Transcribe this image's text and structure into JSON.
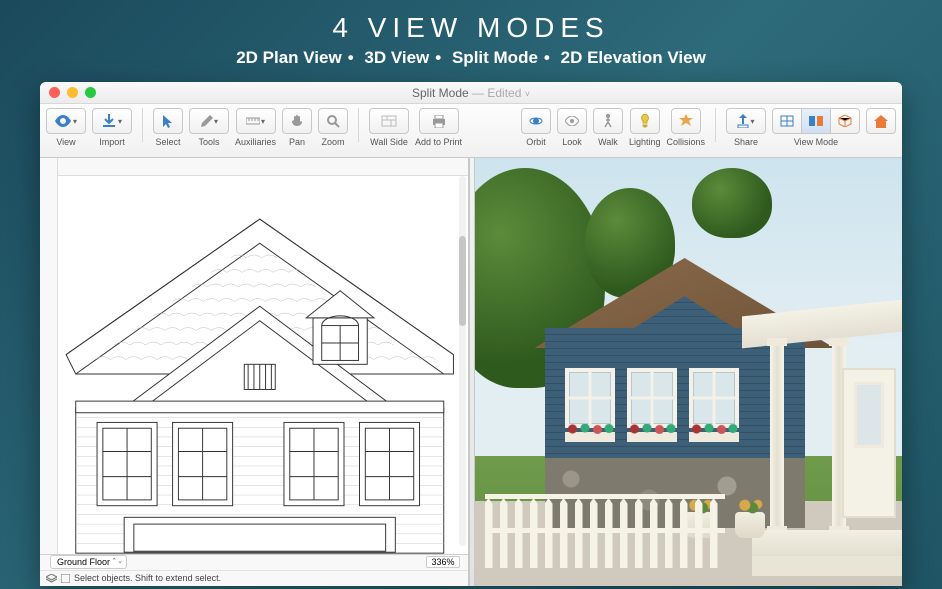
{
  "hero": {
    "title": "4 VIEW MODES",
    "modes": [
      "2D Plan View",
      "3D View",
      "Split Mode",
      "2D Elevation View"
    ]
  },
  "window": {
    "title_main": "Split Mode",
    "title_suffix": "— Edited"
  },
  "toolbar": {
    "view": "View",
    "import": "Import",
    "select": "Select",
    "tools": "Tools",
    "auxiliaries": "Auxiliaries",
    "pan": "Pan",
    "zoom": "Zoom",
    "wall_side": "Wall Side",
    "add_to_print": "Add to Print",
    "orbit": "Orbit",
    "look": "Look",
    "walk": "Walk",
    "lighting": "Lighting",
    "collisions": "Collisions",
    "share": "Share",
    "view_mode": "View Mode"
  },
  "icons": {
    "view": "eye-icon",
    "import": "import-icon",
    "select": "arrow-cursor-icon",
    "tools": "pencil-icon",
    "auxiliaries": "ruler-icon",
    "pan": "hand-icon",
    "zoom": "magnifier-icon",
    "wall_side": "wall-icon",
    "add_to_print": "printer-icon",
    "orbit": "orbit-icon",
    "look": "eye-look-icon",
    "walk": "walk-icon",
    "lighting": "lightbulb-icon",
    "collisions": "collision-icon",
    "share": "share-icon",
    "view_mode_2d": "2d-icon",
    "view_mode_split": "split-icon",
    "view_mode_3d": "3d-icon",
    "inspector": "house-icon"
  },
  "floor": {
    "current": "Ground Floor",
    "zoom": "336%"
  },
  "status": {
    "hint": "Select objects. Shift to extend select."
  }
}
